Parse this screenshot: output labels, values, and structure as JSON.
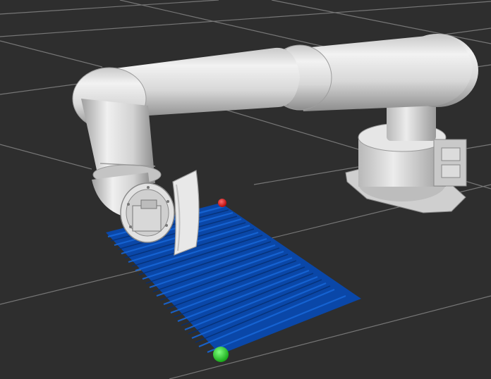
{
  "viewport": {
    "background": "#2e2e2e",
    "grid_color": "#9a9a9a"
  },
  "robot": {
    "color": "#d6d6d6"
  },
  "waypoint_plane": {
    "color": "#0b4fb8"
  },
  "markers": {
    "start_color": "#1ec21e",
    "end_color": "#d01515"
  }
}
